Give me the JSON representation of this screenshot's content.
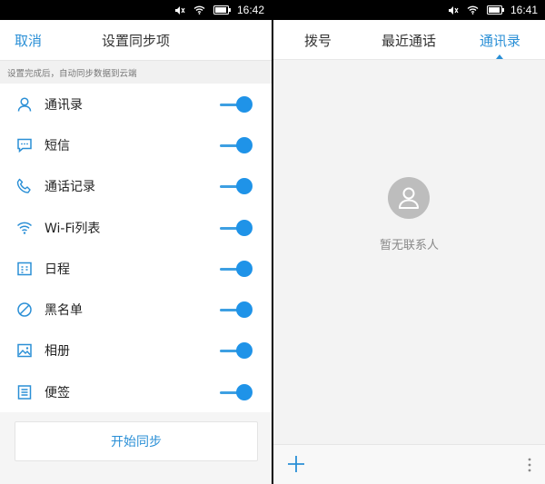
{
  "left": {
    "status": {
      "time": "16:42"
    },
    "header": {
      "cancel": "取消",
      "title": "设置同步项"
    },
    "hint": "设置完成后，自动同步数据到云端",
    "items": [
      {
        "label": "通讯录",
        "icon": "contacts-icon",
        "on": true
      },
      {
        "label": "短信",
        "icon": "sms-icon",
        "on": true
      },
      {
        "label": "通话记录",
        "icon": "phone-icon",
        "on": true
      },
      {
        "label": "Wi-Fi列表",
        "icon": "wifi-icon",
        "on": true
      },
      {
        "label": "日程",
        "icon": "calendar-icon",
        "on": true
      },
      {
        "label": "黑名单",
        "icon": "block-icon",
        "on": true
      },
      {
        "label": "相册",
        "icon": "image-icon",
        "on": true
      },
      {
        "label": "便签",
        "icon": "note-icon",
        "on": true
      }
    ],
    "sync_button": "开始同步"
  },
  "right": {
    "status": {
      "time": "16:41"
    },
    "tabs": [
      {
        "label": "拨号",
        "active": false
      },
      {
        "label": "最近通话",
        "active": false
      },
      {
        "label": "通讯录",
        "active": true
      }
    ],
    "empty_text": "暂无联系人"
  },
  "colors": {
    "accent": "#2a8fd6",
    "toggle": "#1f93e8"
  }
}
